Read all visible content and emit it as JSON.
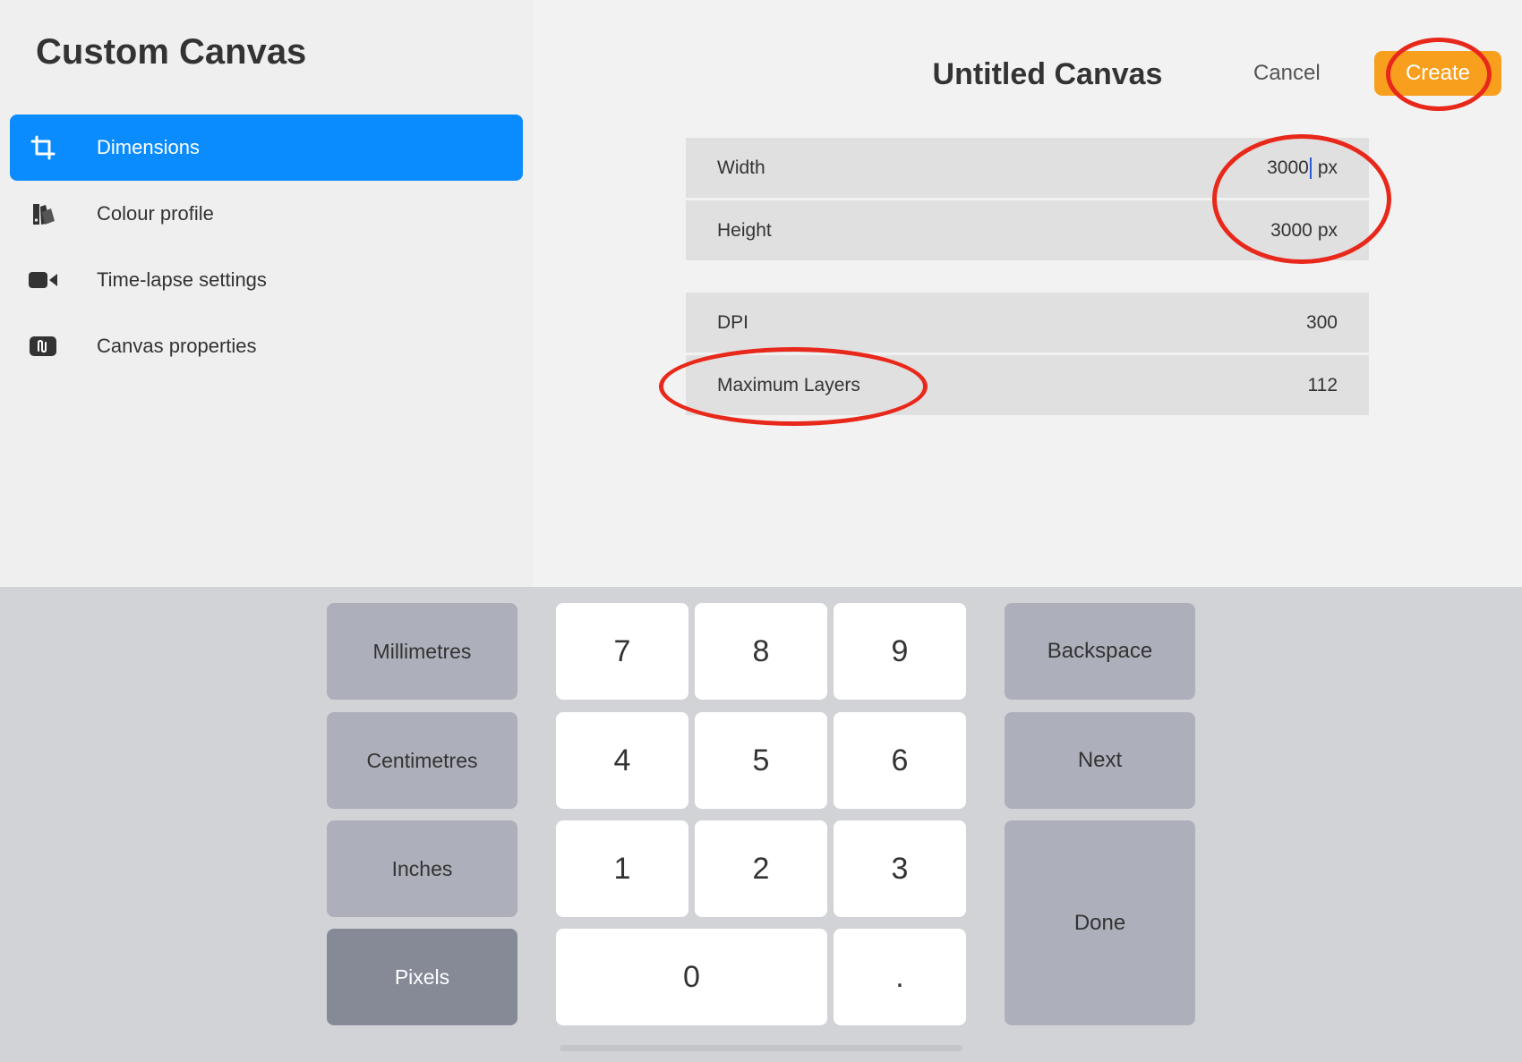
{
  "sidebar": {
    "title": "Custom Canvas",
    "items": [
      {
        "label": "Dimensions",
        "icon": "crop-icon",
        "active": true
      },
      {
        "label": "Colour profile",
        "icon": "colour-swatch-icon",
        "active": false
      },
      {
        "label": "Time-lapse settings",
        "icon": "video-camera-icon",
        "active": false
      },
      {
        "label": "Canvas properties",
        "icon": "canvas-properties-icon",
        "active": false
      }
    ]
  },
  "header": {
    "title": "Untitled Canvas",
    "cancel_label": "Cancel",
    "create_label": "Create"
  },
  "fields": {
    "width": {
      "label": "Width",
      "value": "3000",
      "unit": "px"
    },
    "height": {
      "label": "Height",
      "value": "3000",
      "unit": "px"
    },
    "dpi": {
      "label": "DPI",
      "value": "300"
    },
    "max_layers": {
      "label": "Maximum Layers",
      "value": "112"
    }
  },
  "keyboard": {
    "units": [
      "Millimetres",
      "Centimetres",
      "Inches",
      "Pixels"
    ],
    "selected_unit": "Pixels",
    "digits": [
      "7",
      "8",
      "9",
      "4",
      "5",
      "6",
      "1",
      "2",
      "3",
      "0",
      "."
    ],
    "backspace_label": "Backspace",
    "next_label": "Next",
    "done_label": "Done"
  },
  "colors": {
    "accent_blue": "#0a8cff",
    "create_orange": "#f89f1e",
    "annotation_red": "#e8281a",
    "cursor_blue": "#2a5bd7"
  }
}
